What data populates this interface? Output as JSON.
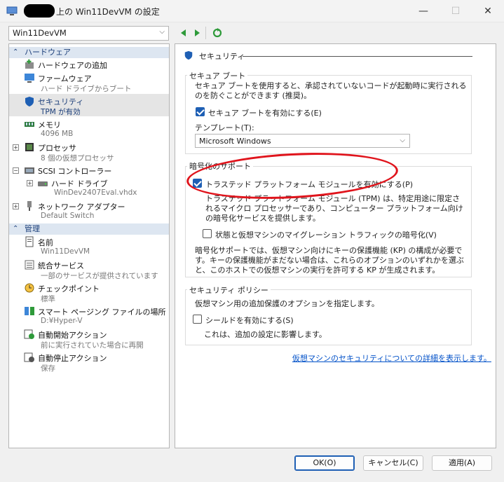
{
  "window": {
    "title": "上の Win11DevVM の設定",
    "minimize": "—",
    "maximize": "☐",
    "close": "✕"
  },
  "vm_selector": {
    "value": "Win11DevVM"
  },
  "tree": {
    "hardware_header": "ハードウェア",
    "items": [
      {
        "label": "ハードウェアの追加",
        "sub": ""
      },
      {
        "label": "ファームウェア",
        "sub": "ハード ドライブからブート"
      },
      {
        "label": "セキュリティ",
        "sub": "TPM が有効"
      },
      {
        "label": "メモリ",
        "sub": "4096 MB"
      },
      {
        "label": "プロセッサ",
        "sub": "8 個の仮想プロセッサ"
      },
      {
        "label": "SCSI コントローラー",
        "sub": ""
      },
      {
        "label": "ハード ドライブ",
        "sub": "WinDev2407Eval.vhdx"
      },
      {
        "label": "ネットワーク アダプター",
        "sub": "Default Switch"
      }
    ],
    "management_header": "管理",
    "mgmt_items": [
      {
        "label": "名前",
        "sub": "Win11DevVM"
      },
      {
        "label": "統合サービス",
        "sub": "一部のサービスが提供されています"
      },
      {
        "label": "チェックポイント",
        "sub": "標準"
      },
      {
        "label": "スマート ページング ファイルの場所",
        "sub": "D:¥Hyper-V"
      },
      {
        "label": "自動開始アクション",
        "sub": "前に実行されていた場合に再開"
      },
      {
        "label": "自動停止アクション",
        "sub": "保存"
      }
    ]
  },
  "panel": {
    "heading": "セキュリティ",
    "secure_boot": {
      "title": "セキュア ブート",
      "desc": "セキュア ブートを使用すると、承認されていないコードが起動時に実行されるのを防ぐことができます (推奨)。",
      "checkbox_label": "セキュア ブートを有効にする(E)",
      "checked": true,
      "template_label": "テンプレート(T):",
      "template_value": "Microsoft Windows"
    },
    "encryption": {
      "title": "暗号化のサポート",
      "tpm_label": "トラステッド プラットフォーム モジュールを有効にする(P)",
      "tpm_checked": true,
      "tpm_desc": "トラステッド プラットフォーム モジュール (TPM) は、特定用途に限定されるマイクロ プロセッサーであり、コンピューター プラットフォーム向けの暗号化サービスを提供します。",
      "migration_label": "状態と仮想マシンのマイグレーション トラフィックの暗号化(V)",
      "migration_checked": false,
      "kp_desc": "暗号化サポートでは、仮想マシン向けにキーの保護機能 (KP) の構成が必要です。キーの保護機能がまだない場合は、これらのオプションのいずれかを選ぶと、このホストでの仮想マシンの実行を許可する KP が生成されます。"
    },
    "policy": {
      "title": "セキュリティ ポリシー",
      "desc": "仮想マシン用の追加保護のオプションを指定します。",
      "shield_label": "シールドを有効にする(S)",
      "shield_checked": false,
      "note": "これは、追加の設定に影響します。"
    },
    "details_link": "仮想マシンのセキュリティについての詳細を表示します。"
  },
  "buttons": {
    "ok": "OK(O)",
    "cancel": "キャンセル(C)",
    "apply": "適用(A)"
  },
  "colors": {
    "accent": "#1e5fb4",
    "annotation": "#e0141c",
    "header_bg": "#dde6f1"
  }
}
